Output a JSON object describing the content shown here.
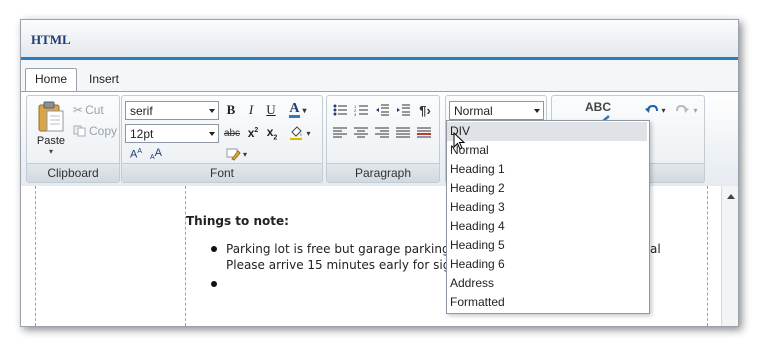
{
  "window": {
    "title": "HTML"
  },
  "tabs": [
    {
      "label": "Home",
      "active": true
    },
    {
      "label": "Insert",
      "active": false
    }
  ],
  "clipboard": {
    "group_label": "Clipboard",
    "paste_label": "Paste",
    "cut_label": "Cut",
    "copy_label": "Copy"
  },
  "font": {
    "group_label": "Font",
    "family_value": "serif",
    "size_value": "12pt"
  },
  "paragraph": {
    "group_label": "Paragraph"
  },
  "styles": {
    "selected": "Normal"
  },
  "proofing": {
    "spell_label": "ABC"
  },
  "document": {
    "heading": "Things to note:",
    "bullets": [
      "Parking lot is free but garage parking i",
      "Please arrive 15 minutes early for sign",
      ""
    ],
    "clipped_tail": "al"
  },
  "style_dropdown": {
    "options": [
      "DIV",
      "Normal",
      "Heading 1",
      "Heading 2",
      "Heading 3",
      "Heading 4",
      "Heading 5",
      "Heading 6",
      "Address",
      "Formatted"
    ],
    "highlighted_index": 0
  },
  "colors": {
    "accent": "#2a7bc4",
    "title": "#1f3c73",
    "highlight": "#dfe3e8"
  }
}
